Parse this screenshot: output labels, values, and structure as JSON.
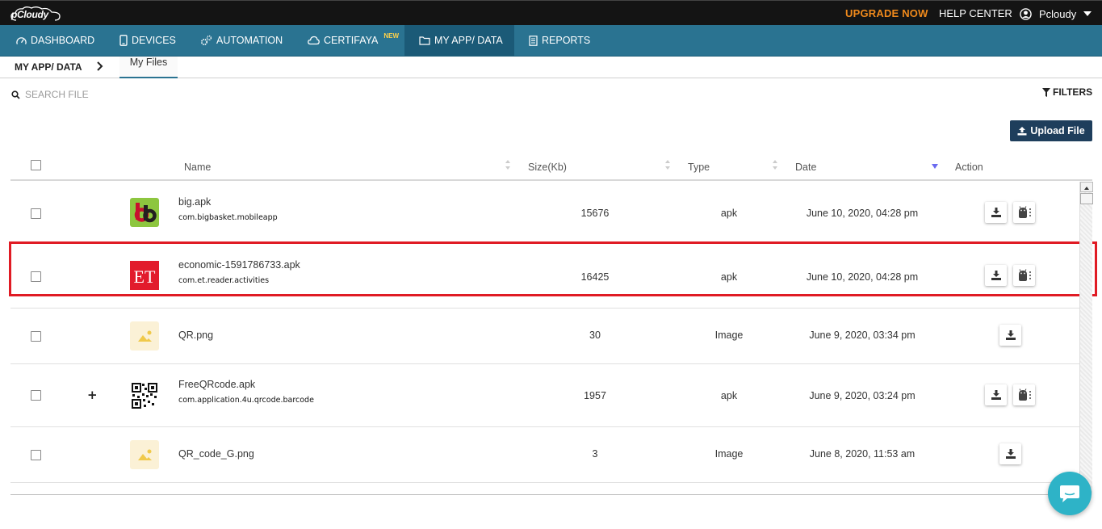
{
  "topbar": {
    "logo": "pCloudy",
    "upgrade": "UPGRADE NOW",
    "help": "HELP CENTER",
    "user": "Pcloudy"
  },
  "nav": {
    "items": [
      {
        "label": "DASHBOARD",
        "icon": "dashboard-icon"
      },
      {
        "label": "DEVICES",
        "icon": "mobile-icon"
      },
      {
        "label": "AUTOMATION",
        "icon": "gears-icon"
      },
      {
        "label": "CERTIFAYA",
        "icon": "cloud-icon",
        "badge": "NEW"
      },
      {
        "label": "MY APP/ DATA",
        "icon": "folder-icon",
        "active": true
      },
      {
        "label": "REPORTS",
        "icon": "document-icon"
      }
    ]
  },
  "breadcrumb": {
    "root": "MY APP/ DATA",
    "current": "My Files"
  },
  "search": {
    "placeholder": "SEARCH FILE"
  },
  "filters_label": "FILTERS",
  "upload_label": "Upload File",
  "table": {
    "headers": {
      "name": "Name",
      "size": "Size(Kb)",
      "type": "Type",
      "date": "Date",
      "action": "Action"
    },
    "rows": [
      {
        "name": "big.apk",
        "package": "com.bigbasket.mobileapp",
        "size": "15676",
        "type": "apk",
        "date": "June 10, 2020, 04:28 pm",
        "icon": "bigbasket-app-icon"
      },
      {
        "name": "economic-1591786733.apk",
        "package": "com.et.reader.activities",
        "size": "16425",
        "type": "apk",
        "date": "June 10, 2020, 04:28 pm",
        "icon": "et-app-icon",
        "icon_text": "ET",
        "highlighted": true
      },
      {
        "name": "QR.png",
        "package": "",
        "size": "30",
        "type": "Image",
        "date": "June 9, 2020, 03:34 pm",
        "icon": "image-icon"
      },
      {
        "name": "FreeQRcode.apk",
        "package": "com.application.4u.qrcode.barcode",
        "size": "1957",
        "type": "apk",
        "date": "June 9, 2020, 03:24 pm",
        "icon": "qrcode-app-icon"
      },
      {
        "name": "QR_code_G.png",
        "package": "",
        "size": "3",
        "type": "Image",
        "date": "June 8, 2020, 11:53 am",
        "icon": "image-icon"
      }
    ]
  },
  "colors": {
    "nav_bg": "#2a7391",
    "nav_active": "#1b5a77",
    "upgrade": "#f08a1c",
    "upload_bg": "#1e3e5c",
    "highlight": "#e01b24",
    "chat": "#2eb3c7"
  }
}
